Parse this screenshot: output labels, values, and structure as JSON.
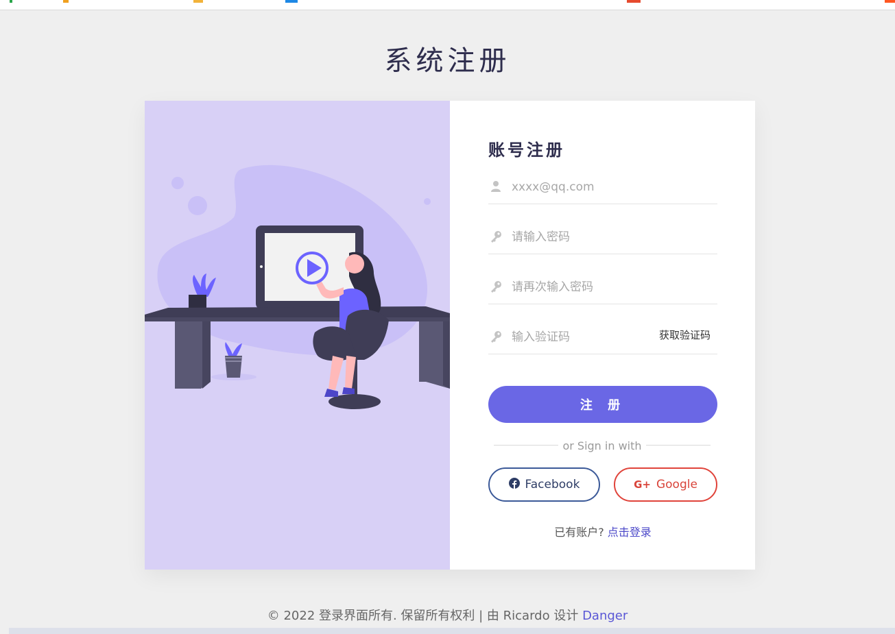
{
  "page": {
    "title": "系统注册"
  },
  "form": {
    "heading": "账号注册",
    "email_placeholder": "xxxx@qq.com",
    "password_placeholder": "请输入密码",
    "confirm_placeholder": "请再次输入密码",
    "code_placeholder": "输入验证码",
    "get_code_label": "获取验证码",
    "submit_label": "注 册",
    "divider_text": "or Sign in with",
    "facebook_label": "Facebook",
    "google_label": "Google",
    "has_account_text": "已有账户? ",
    "login_link": "点击登录"
  },
  "footer": {
    "text": "© 2022 登录界面所有. 保留所有权利 | 由 Ricardo 设计 ",
    "link": "Danger"
  },
  "icons": {
    "email_field": "user-icon",
    "password_field": "key-icon",
    "confirm_field": "key-icon",
    "code_field": "key-icon",
    "facebook": "facebook-icon",
    "google": "google-plus-icon"
  },
  "colors": {
    "accent": "#6a67e5",
    "illustration_bg": "#d8d0f6",
    "facebook": "#3b5998",
    "google": "#e0433a",
    "title": "#2e2d4d"
  }
}
